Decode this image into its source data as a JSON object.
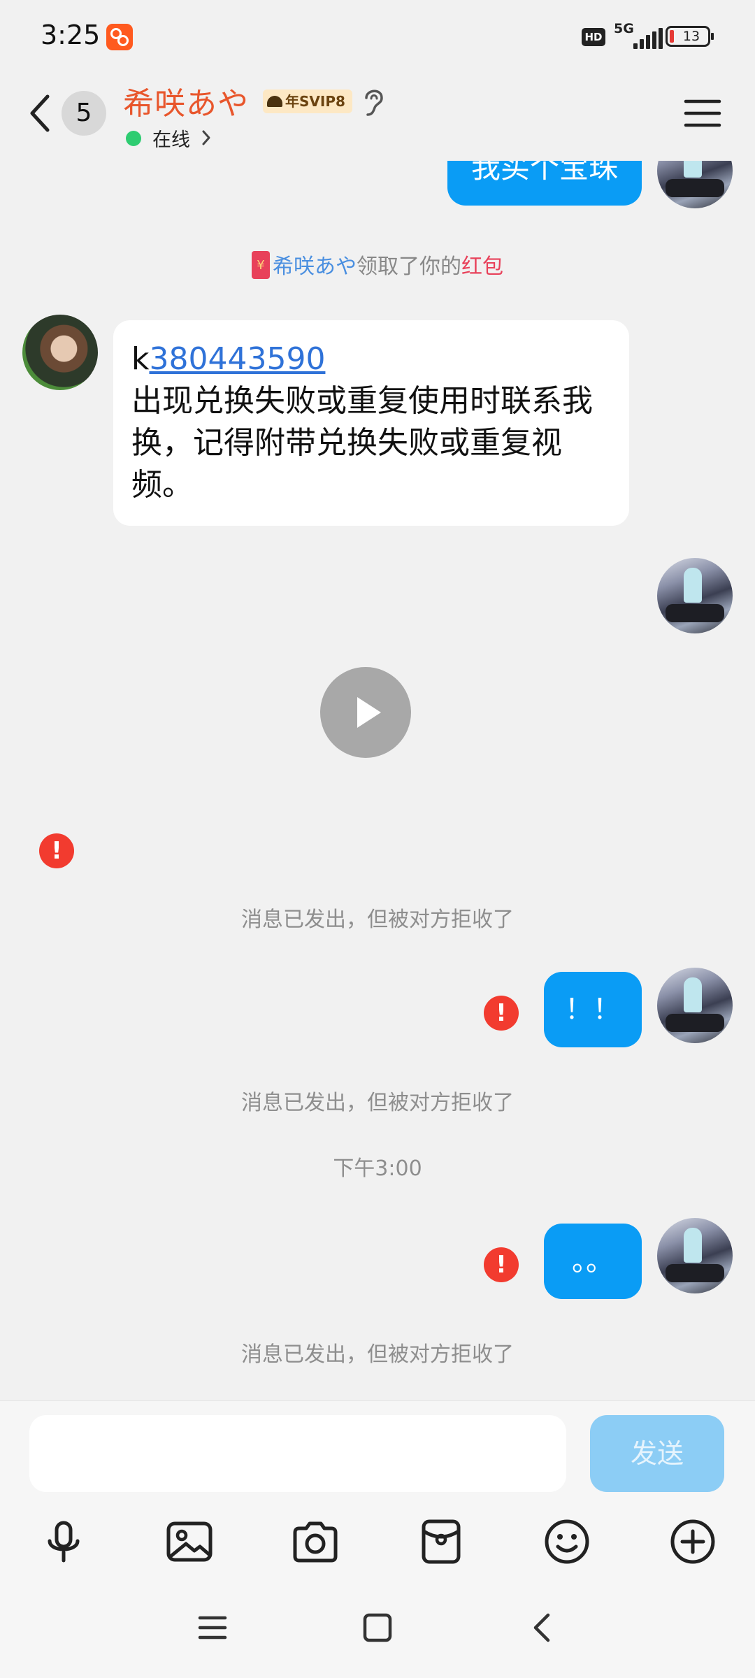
{
  "status_bar": {
    "time": "3:25",
    "hd": "HD",
    "network": "5G",
    "battery": "13",
    "battery_color": "#e53935"
  },
  "header": {
    "unread_count": "5",
    "contact_name": "希咲あや",
    "vip_badge": "年SVIP8",
    "status": "在线",
    "name_color": "#e8562c",
    "icons": [
      "back-icon",
      "ear-icon",
      "menu-icon"
    ]
  },
  "chat": {
    "top_bubble": "我买个宝珠",
    "red_packet_notice": {
      "name": "希咲あや",
      "middle": "领取了你的",
      "link": "红包"
    },
    "incoming_message": {
      "prefix": "k",
      "link": "380443590",
      "body": "出现兑换失败或重复使用时联系我换，记得附带兑换失败或重复视频。"
    },
    "rejected_notice_1": "消息已发出，但被对方拒收了",
    "bubble_exclaim": "！！",
    "rejected_notice_2": "消息已发出，但被对方拒收了",
    "timestamp": "下午3:00",
    "bubble_dots": "。。",
    "rejected_notice_3": "消息已发出，但被对方拒收了",
    "bubble_color": "#0a9cf5"
  },
  "input_bar": {
    "placeholder": "",
    "send_label": "发送"
  },
  "toolbar": {
    "icons": [
      "microphone-icon",
      "image-icon",
      "camera-icon",
      "red-packet-icon",
      "emoji-icon",
      "plus-icon"
    ]
  },
  "nav_bar": {
    "icons": [
      "recent-apps-icon",
      "home-icon",
      "back-nav-icon"
    ]
  }
}
